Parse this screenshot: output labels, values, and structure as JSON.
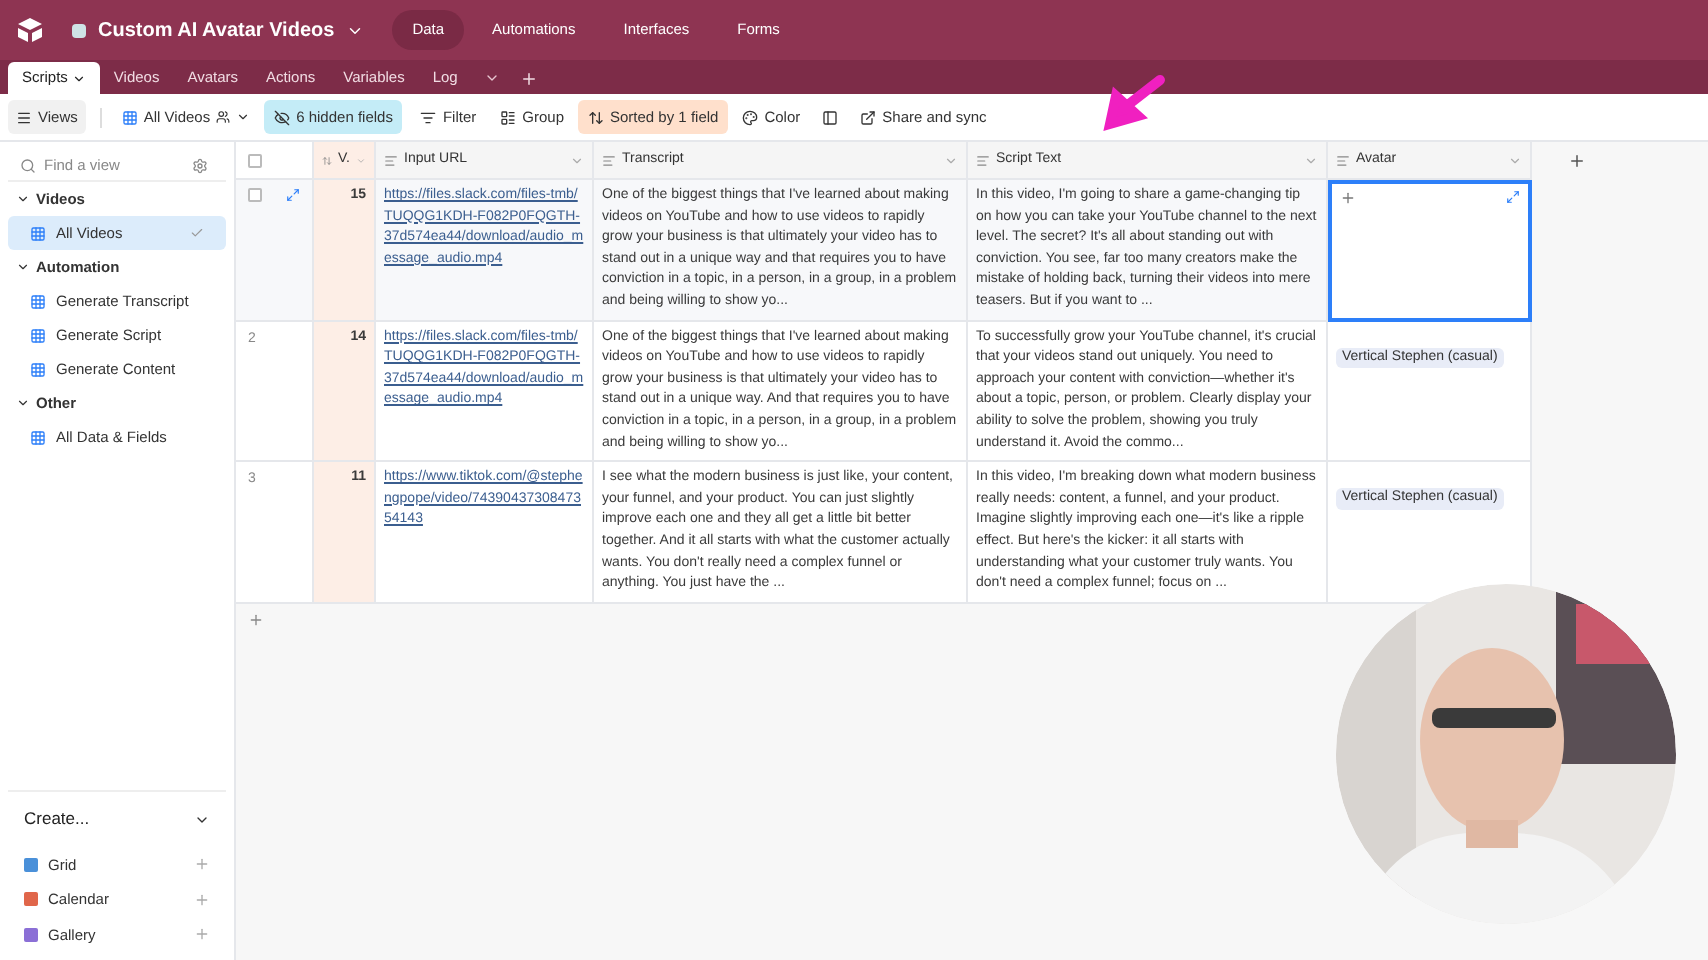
{
  "app": {
    "base_name": "Custom AI Avatar Videos"
  },
  "top_nav": [
    {
      "label": "Data",
      "selected": true
    },
    {
      "label": "Automations",
      "selected": false
    },
    {
      "label": "Interfaces",
      "selected": false
    },
    {
      "label": "Forms",
      "selected": false
    }
  ],
  "tables": [
    {
      "label": "Scripts",
      "selected": true
    },
    {
      "label": "Videos",
      "selected": false
    },
    {
      "label": "Avatars",
      "selected": false
    },
    {
      "label": "Actions",
      "selected": false
    },
    {
      "label": "Variables",
      "selected": false
    },
    {
      "label": "Log",
      "selected": false
    }
  ],
  "toolbar": {
    "views": "Views",
    "view_name": "All Videos",
    "hidden_fields": "6 hidden fields",
    "filter": "Filter",
    "group": "Group",
    "sort": "Sorted by 1 field",
    "color_label": "Color",
    "share": "Share and sync"
  },
  "sidebar": {
    "search": {
      "placeholder": "Find a view"
    },
    "sections": [
      {
        "title": "Videos",
        "expanded": true,
        "items": [
          {
            "label": "All Videos",
            "selected": true
          }
        ]
      },
      {
        "title": "Automation",
        "expanded": true,
        "items": [
          {
            "label": "Generate Transcript",
            "selected": false
          },
          {
            "label": "Generate Script",
            "selected": false
          },
          {
            "label": "Generate Content",
            "selected": false
          }
        ]
      },
      {
        "title": "Other",
        "expanded": true,
        "items": [
          {
            "label": "All Data & Fields",
            "selected": false
          }
        ]
      }
    ],
    "create": {
      "title": "Create...",
      "items": [
        {
          "label": "Grid",
          "color": "#4a90d9"
        },
        {
          "label": "Calendar",
          "color": "#e0664a"
        },
        {
          "label": "Gallery",
          "color": "#8b6fd6"
        }
      ]
    }
  },
  "table": {
    "columns": [
      "V.",
      "Input URL",
      "Transcript",
      "Script Text",
      "Avatar"
    ],
    "all_checked": false,
    "rows": [
      {
        "number": null,
        "checked": false,
        "v": "15",
        "url": "https://files.slack.com/files-tmb/TUQQG1KDH-F082P0FQGTH-37d574ea44/download/audio_message_audio.mp4",
        "transcript": "One of the biggest things that I've learned about making videos on YouTube and how to use videos to rapidly grow your business is that ultimately your video has to stand out in a unique way and that requires you to have conviction in a topic, in a person, in a group, in a problem and being willing to show yo...",
        "script": "In this video, I'm going to share a game-changing tip on how you can take your YouTube channel to the next level. The secret? It's all about standing out with conviction. You see, far too many creators make the mistake of holding back, turning their videos into mere teasers. But if you want to ...",
        "avatar": null,
        "selected": true
      },
      {
        "number": "2",
        "v": "14",
        "url": "https://files.slack.com/files-tmb/TUQQG1KDH-F082P0FQGTH-37d574ea44/download/audio_message_audio.mp4",
        "transcript": "One of the biggest things that I've learned about making videos on YouTube and how to use videos to rapidly grow your business is that ultimately your video has to stand out in a unique way. And that requires you to have conviction in a topic, in a person, in a group, in a problem and being willing to show yo...",
        "script": "To successfully grow your YouTube channel, it's crucial that your videos stand out uniquely. You need to approach your content with conviction—whether it's about a topic, person, or problem. Clearly display your ability to solve the problem, showing you truly understand it. Avoid the commo...",
        "avatar": "Vertical Stephen (casual)",
        "selected": false
      },
      {
        "number": "3",
        "v": "11",
        "url": "https://www.tiktok.com/@stephengpope/video/7439043730847354143",
        "transcript": "I see what the modern business is just like, your content, your funnel, and your product. You can just slightly improve each one and they all get a little bit better together. And it all starts with what the customer actually wants. You don't really need a complex funnel or anything. You just have the ...",
        "script": "In this video, I'm breaking down what modern business really needs: content, a funnel, and your product. Imagine slightly improving each one—it's like a ripple effect. But here's the kicker: it all starts with understanding what your customer truly wants. You don't need a complex funnel; focus on ...",
        "avatar": "Vertical Stephen (casual)",
        "selected": false
      }
    ]
  }
}
